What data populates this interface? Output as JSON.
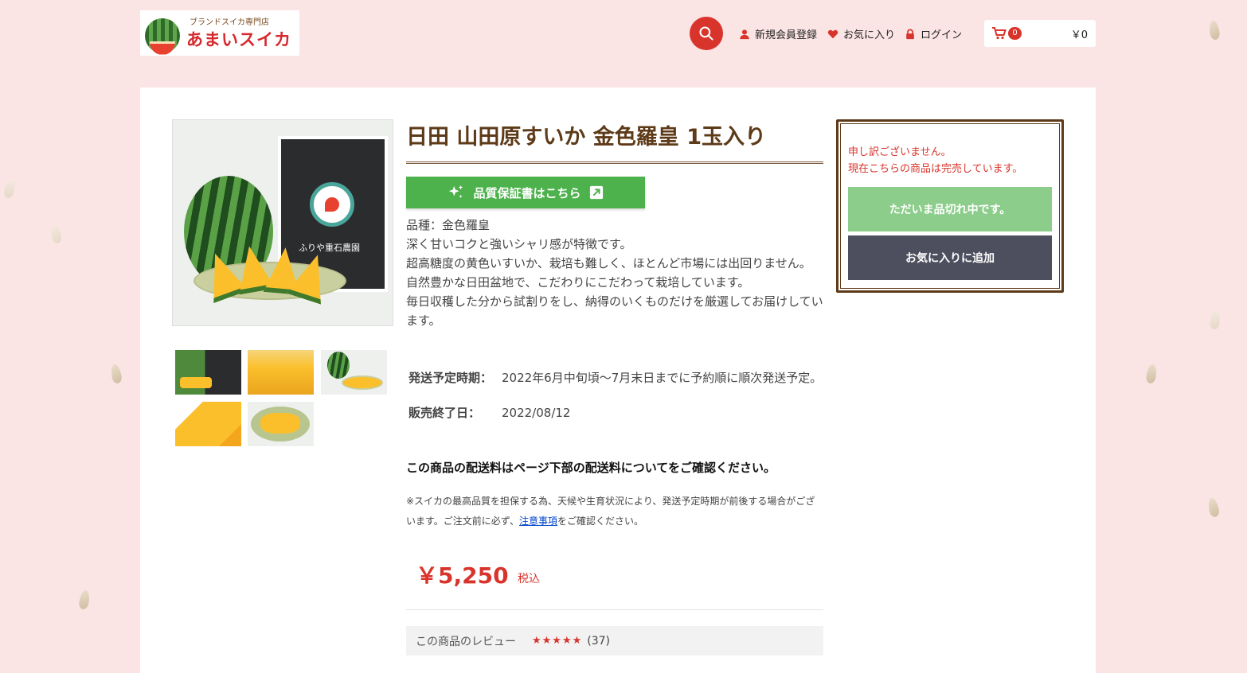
{
  "header": {
    "logo_sub": "ブランドスイカ専門店",
    "logo_main": "あまいスイカ",
    "register_label": "新規会員登録",
    "favorites_label": "お気に入り",
    "login_label": "ログイン",
    "cart_count": "0",
    "cart_total": "￥0"
  },
  "product": {
    "title": "日田 山田原すいか 金色羅皇 1玉入り",
    "cert_button": "品質保証書はこちら",
    "package_label": "ふりや重石農園",
    "description": [
      "品種：金色羅皇",
      "深く甘いコクと強いシャリ感が特徴です。",
      "超高糖度の黄色いすいか、栽培も難しく、ほとんど市場には出回りません。",
      "自然豊かな日田盆地で、こだわりにこだわって栽培しています。",
      "毎日収穫した分から試割りをし、納得のいくものだけを厳選してお届けしています。"
    ],
    "specs": [
      {
        "key": "発送予定時期：",
        "value": "2022年6月中旬頃～7月末日までに予約順に順次発送予定。"
      },
      {
        "key": "販売終了日：",
        "value": "2022/08/12"
      }
    ],
    "shipping_note": "この商品の配送料はページ下部の配送料についてをご確認ください。",
    "small_note_before": "※スイカの最高品質を担保する為、天候や生育状況により、発送予定時期が前後する場合がございます。ご注文前に必ず、",
    "small_note_link": "注意事項",
    "small_note_after": "をご確認ください。",
    "price": "￥5,250",
    "tax_label": "税込",
    "review_label": "この商品のレビュー",
    "review_stars": "★★★★★",
    "review_count": "(37)"
  },
  "sidebox": {
    "sorry_line1": "申し訳ございません。",
    "sorry_line2": "現在こちらの商品は完売しています。",
    "soldout_button": "ただいま品切れ中です。",
    "favorite_button": "お気に入りに追加"
  },
  "icons": {
    "search": "search-icon",
    "user": "user-icon",
    "heart": "heart-icon",
    "lock": "lock-icon",
    "cart": "cart-icon",
    "sparkle": "sparkle-icon",
    "external": "external-link-icon"
  },
  "colors": {
    "accent_red": "#d8342c",
    "brand_brown": "#5d3a18",
    "cert_green": "#4db14c",
    "soldout_green": "#8ccd8b",
    "fav_dark": "#4e4f5e",
    "background_pink": "#fbe4e4"
  }
}
